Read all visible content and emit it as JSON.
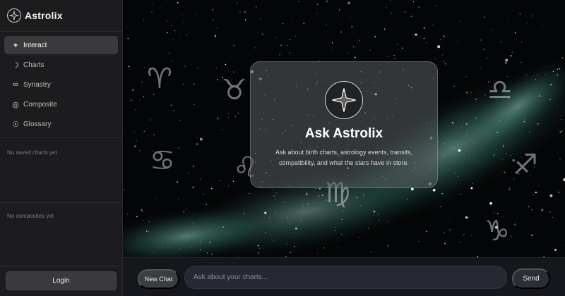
{
  "app": {
    "title": "Astrolix"
  },
  "sidebar": {
    "nav": [
      {
        "label": "Interact",
        "icon": "sparkle-icon",
        "glyph": "✦",
        "active": true
      },
      {
        "label": "Charts",
        "icon": "moon-icon",
        "glyph": "☽",
        "active": false
      },
      {
        "label": "Synastry",
        "icon": "infinity-icon",
        "glyph": "∞",
        "active": false
      },
      {
        "label": "Composite",
        "icon": "target-icon",
        "glyph": "◎",
        "active": false
      },
      {
        "label": "Glossary",
        "icon": "sun-icon",
        "glyph": "☉",
        "active": false
      }
    ],
    "saved_empty": "No saved charts yet",
    "composites_empty": "No composites yet",
    "login_label": "Login"
  },
  "hero": {
    "title": "Ask Astrolix",
    "subtitle": "Ask about birth charts, astrology events, transits, compatibility, and what the stars have in store."
  },
  "zodiac_glyphs": [
    "♈",
    "♉",
    "♎",
    "♋",
    "♌",
    "♍",
    "♐",
    "♑"
  ],
  "composer": {
    "new_chat_label": "New Chat",
    "placeholder": "Ask about your charts...",
    "send_label": "Send"
  },
  "colors": {
    "sidebar_bg": "#1c1c1e",
    "nav_active_bg": "#3a3a3d",
    "nebula": "#5fb3a0"
  }
}
